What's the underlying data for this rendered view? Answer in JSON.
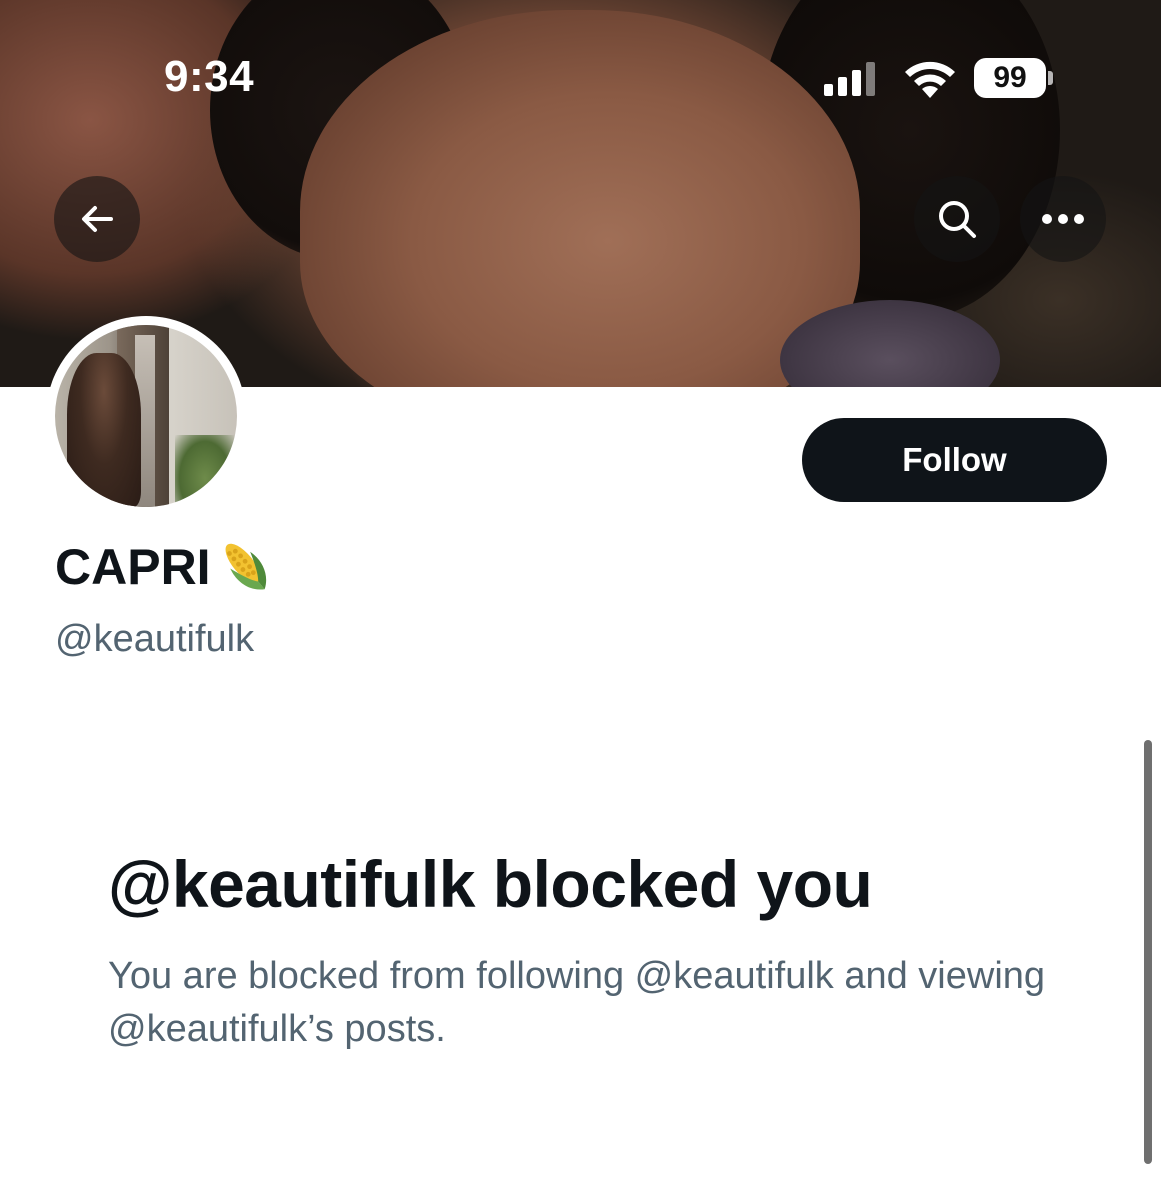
{
  "status_bar": {
    "time": "9:34",
    "battery": "99"
  },
  "header": {
    "back_icon": "arrow-left-icon",
    "search_icon": "search-icon",
    "more_icon": "more-dots-icon"
  },
  "profile": {
    "display_name": "CAPRI",
    "name_emoji": "corn-icon",
    "handle": "@keautifulk",
    "follow_label": "Follow"
  },
  "blocked": {
    "title": "@keautifulk blocked you",
    "description": "You are blocked from following @keautifulk and viewing @keautifulk’s posts."
  },
  "colors": {
    "primary_text": "#0f1419",
    "secondary_text": "#536471",
    "follow_bg": "#0f1419",
    "background": "#ffffff"
  }
}
